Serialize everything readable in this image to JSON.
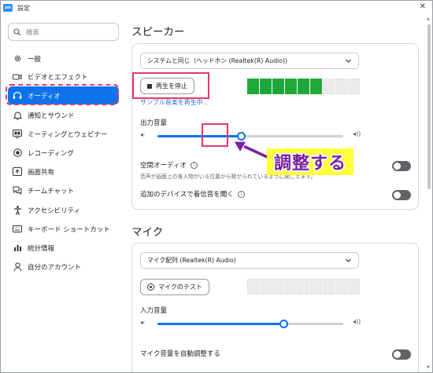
{
  "window": {
    "title": "設定",
    "app_badge": "zm"
  },
  "search": {
    "placeholder": "検索"
  },
  "sidebar": {
    "items": [
      {
        "label": "一般",
        "icon": "gear-icon"
      },
      {
        "label": "ビデオとエフェクト",
        "icon": "video-icon"
      },
      {
        "label": "オーディオ",
        "icon": "headphones-icon",
        "active": true
      },
      {
        "label": "通知とサウンド",
        "icon": "bell-icon"
      },
      {
        "label": "ミーティングとウェビナー",
        "icon": "meeting-icon"
      },
      {
        "label": "レコーディング",
        "icon": "record-icon"
      },
      {
        "label": "画面共有",
        "icon": "share-screen-icon"
      },
      {
        "label": "チームチャット",
        "icon": "chat-icon"
      },
      {
        "label": "アクセシビリティ",
        "icon": "accessibility-icon"
      },
      {
        "label": "キーボード ショートカット",
        "icon": "keyboard-icon"
      },
      {
        "label": "統計情報",
        "icon": "stats-icon"
      },
      {
        "label": "自分のアカウント",
        "icon": "account-icon"
      }
    ]
  },
  "speaker": {
    "title": "スピーカー",
    "device": "システムと同じ（ヘッドホン (Realtek(R) Audio))",
    "stop_button": "再生を停止",
    "playing_text": "サンプル音楽を再生中...",
    "output_label": "出力音量",
    "output_volume": 0.45,
    "level_active_segments": 6,
    "level_total_segments": 9,
    "level_color": "#1fa83a",
    "spatial_label": "空間オーディオ",
    "spatial_desc": "音声が画面上の各人物がいる位置から発せられているように聞こえます。",
    "spatial_on": false,
    "extra_device_label": "追加のデバイスで着信音を聞く",
    "extra_device_on": false
  },
  "mic": {
    "title": "マイク",
    "device": "マイク配列 (Realtek(R) Audio)",
    "test_button": "マイクのテスト",
    "input_label": "入力音量",
    "input_volume": 0.68,
    "level_active_segments": 0,
    "level_total_segments": 9,
    "auto_adjust_label": "マイク音量を自動調整する",
    "auto_adjust_on": false
  },
  "annotation": {
    "callout": "調整する",
    "callout_color": "#7a1fa2",
    "callout_bg": "#ffff3a",
    "box_color": "#e8366a"
  },
  "colors": {
    "accent": "#0e72ed"
  }
}
